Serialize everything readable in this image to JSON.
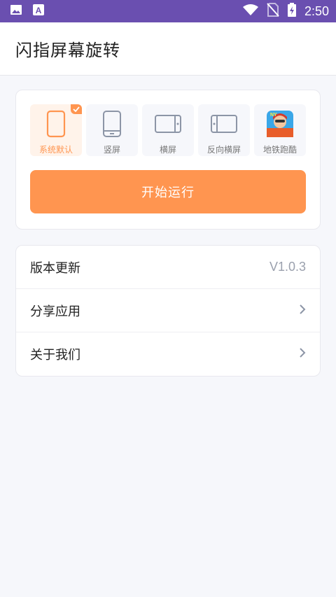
{
  "status_bar": {
    "time": "2:50",
    "icons": [
      "image-icon",
      "a-notification-icon",
      "wifi-icon",
      "no-sim-icon",
      "battery-charging-icon"
    ]
  },
  "header": {
    "title": "闪指屏幕旋转"
  },
  "modes": {
    "items": [
      {
        "label": "系统默认",
        "icon": "phone-outline-icon",
        "selected": true
      },
      {
        "label": "竖屏",
        "icon": "portrait-phone-icon",
        "selected": false
      },
      {
        "label": "横屏",
        "icon": "landscape-phone-icon",
        "selected": false
      },
      {
        "label": "反向横屏",
        "icon": "reverse-landscape-icon",
        "selected": false
      },
      {
        "label": "地铁跑酷",
        "icon": "subway-surfers-icon",
        "selected": false
      }
    ],
    "start_label": "开始运行"
  },
  "settings": {
    "items": [
      {
        "label": "版本更新",
        "value": "V1.0.3"
      },
      {
        "label": "分享应用"
      },
      {
        "label": "关于我们"
      }
    ]
  },
  "colors": {
    "accent": "#ff9550",
    "status_bar": "#6a4fb0",
    "icon_gray": "#8c95a6"
  }
}
